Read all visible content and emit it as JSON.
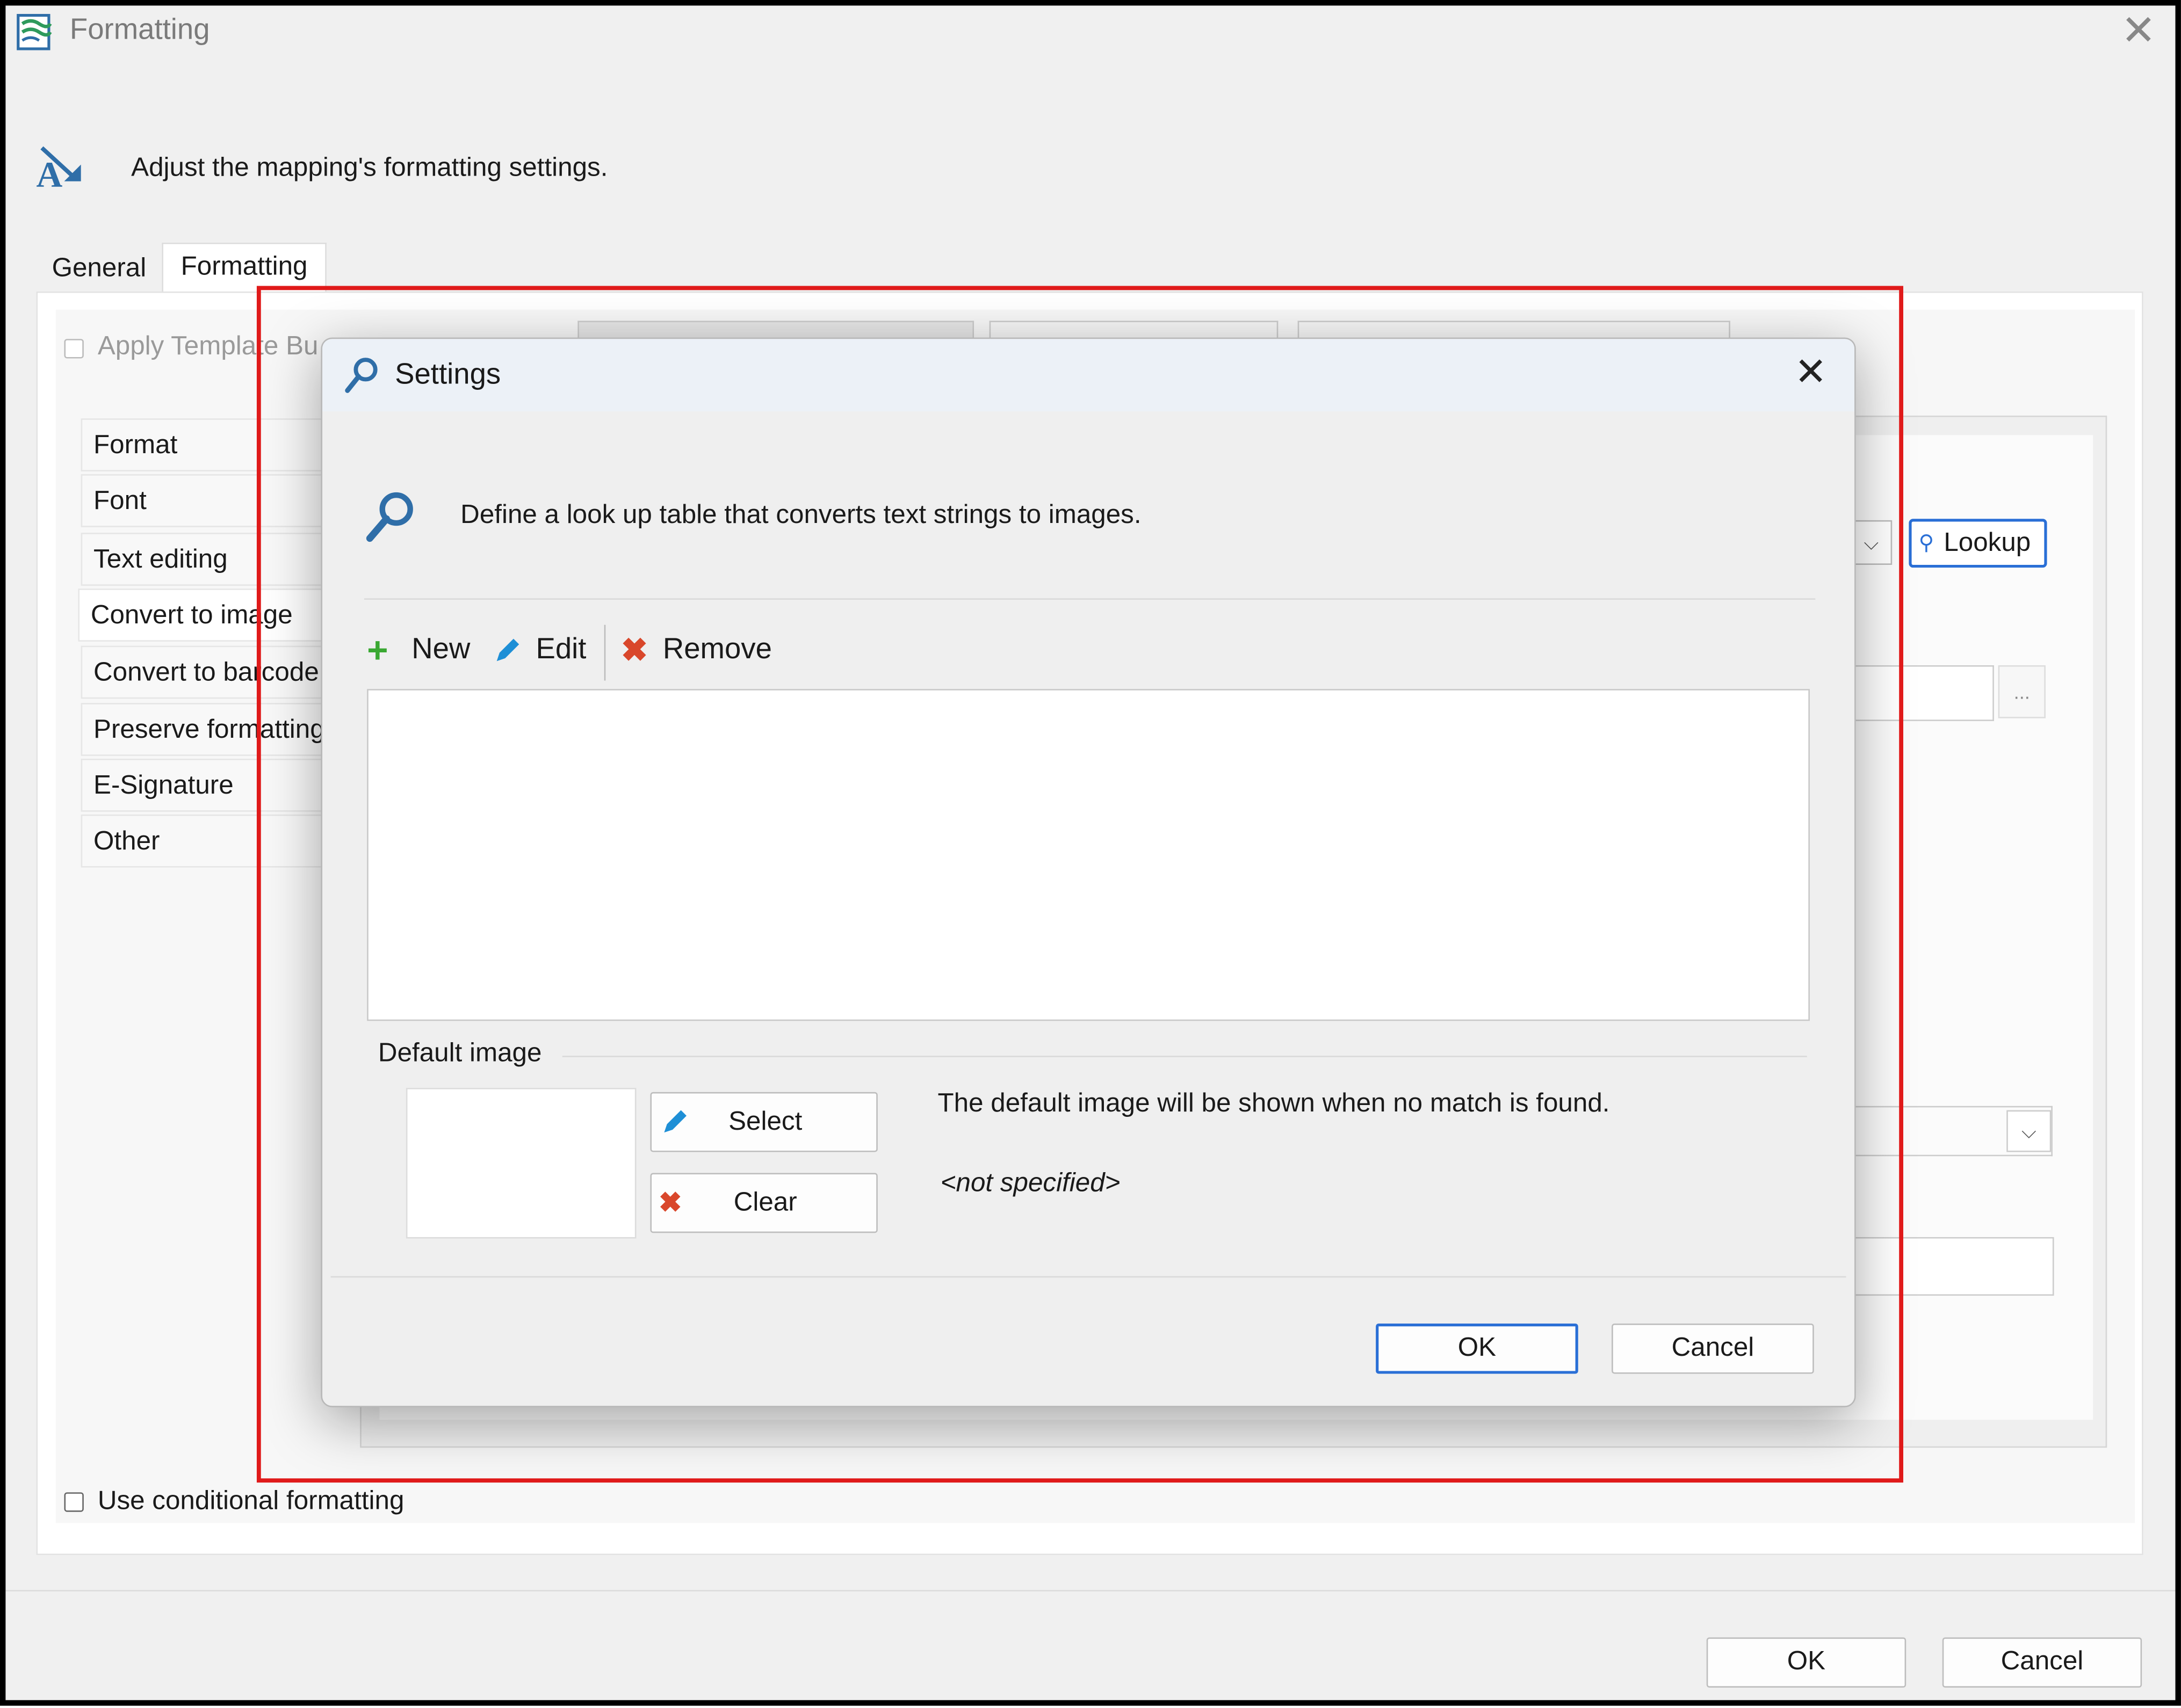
{
  "window": {
    "title": "Formatting",
    "description": "Adjust the mapping's formatting settings."
  },
  "tabs": [
    {
      "label": "General"
    },
    {
      "label": "Formatting"
    }
  ],
  "apply_template": {
    "label": "Apply Template Bu"
  },
  "sidebar": {
    "items": [
      {
        "label": "Format"
      },
      {
        "label": "Font"
      },
      {
        "label": "Text editing"
      },
      {
        "label": "Convert to image"
      },
      {
        "label": "Convert to barcode"
      },
      {
        "label": "Preserve formatting"
      },
      {
        "label": "E-Signature"
      },
      {
        "label": "Other"
      }
    ]
  },
  "background_panel": {
    "lookup_label": "Lookup",
    "browse_label": "..."
  },
  "conditional": {
    "label": "Use conditional formatting"
  },
  "footer": {
    "ok": "OK",
    "cancel": "Cancel"
  },
  "dialog": {
    "title": "Settings",
    "description": "Define a look up table that converts text strings to images.",
    "toolbar": {
      "new": "New",
      "edit": "Edit",
      "remove": "Remove"
    },
    "default_image": {
      "section_label": "Default image",
      "select": "Select",
      "clear": "Clear",
      "info": "The default image will be shown when no match is found.",
      "value": "<not specified>"
    },
    "ok": "OK",
    "cancel": "Cancel"
  },
  "colors": {
    "accent": "#2a6fd6",
    "highlight_box": "#e01a1a",
    "add_icon": "#3aa832",
    "remove_icon": "#d9472b",
    "edit_icon": "#1e8fd6"
  }
}
